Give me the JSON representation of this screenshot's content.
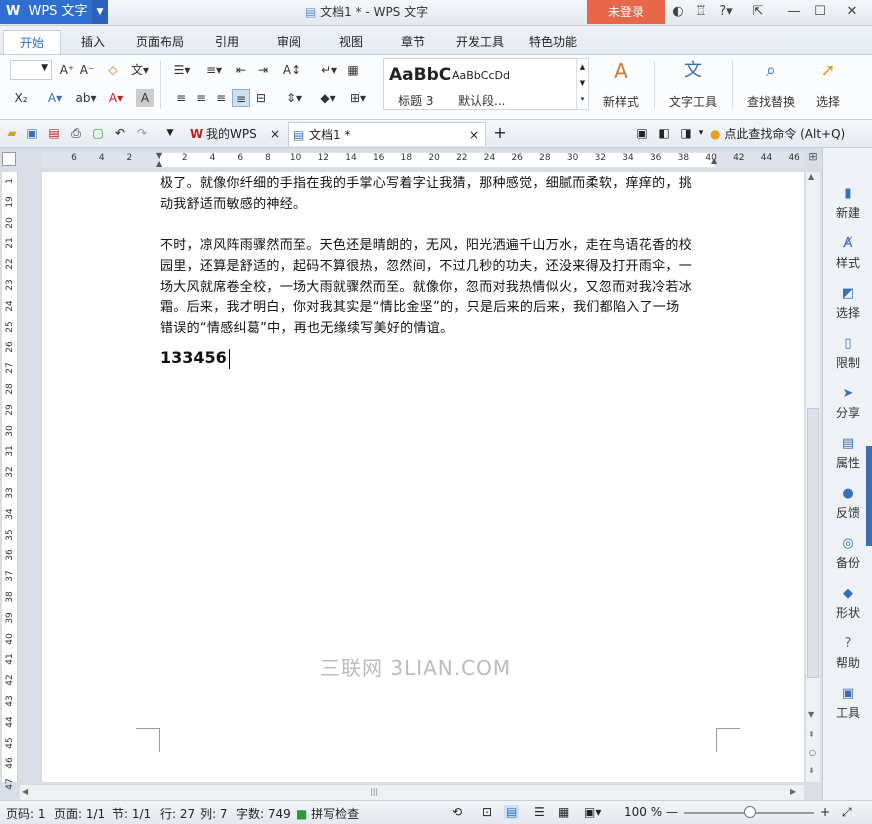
{
  "app": {
    "name": "WPS 文字",
    "window_title": "文档1 * - WPS 文字",
    "login_label": "未登录"
  },
  "menu": {
    "tabs": [
      "开始",
      "插入",
      "页面布局",
      "引用",
      "审阅",
      "视图",
      "章节",
      "开发工具",
      "特色功能"
    ]
  },
  "ribbon": {
    "style_preview_big": "AaBbC",
    "style_preview_small": "AaBbCcDd",
    "style_heading_label": "标题 3",
    "style_default_label": "默认段...",
    "new_style_label": "新样式",
    "text_tools_label": "文字工具",
    "find_replace_label": "查找替换",
    "select_label": "选择"
  },
  "doc_tabs": {
    "home": "我的WPS",
    "doc": "文档1 *"
  },
  "search_hint": "点此查找命令 (Alt+Q)",
  "ruler": {
    "h_numbers": [
      "6",
      "4",
      "2",
      "",
      "2",
      "4",
      "6",
      "8",
      "10",
      "12",
      "14",
      "16",
      "18",
      "20",
      "22",
      "24",
      "26",
      "28",
      "30",
      "32",
      "34",
      "36",
      "38",
      "40",
      "42",
      "44",
      "46"
    ],
    "v_numbers": [
      "1",
      "19",
      "20",
      "21",
      "22",
      "23",
      "24",
      "25",
      "26",
      "27",
      "28",
      "29",
      "30",
      "31",
      "32",
      "33",
      "34",
      "35",
      "36",
      "37",
      "38",
      "39",
      "40",
      "41",
      "42",
      "43",
      "44",
      "45",
      "46",
      "47"
    ]
  },
  "document": {
    "para1_line1": "极了。就像你纤细的手指在我的手掌心写着字让我猜，那种感觉，细腻而柔软，痒痒的，挑",
    "para1_line2": "动我舒适而敏感的神经。",
    "para2_line1": "不时，凉风阵雨骤然而至。天色还是晴朗的，无风，阳光洒遍千山万水，走在鸟语花香的校",
    "para2_line2": "园里，还算是舒适的，起码不算很热，忽然间，不过几秒的功夫，还没来得及打开雨伞，一",
    "para2_line3": "场大风就席卷全校，一场大雨就骤然而至。就像你，忽而对我热情似火，又忽而对我冷若冰",
    "para2_line4": "霜。后来，我才明白，你对我其实是“情比金坚”的，只是后来的后来，我们都陷入了一场",
    "para2_line5": "错误的“情感纠葛”中，再也无缘续写美好的情谊。",
    "typed_text": "133456",
    "watermark": "三联网 3LIAN.COM"
  },
  "sidebar": {
    "items": [
      "新建",
      "样式",
      "选择",
      "限制",
      "分享",
      "属性",
      "反馈",
      "备份",
      "形状",
      "帮助",
      "工具"
    ]
  },
  "status": {
    "page_code": "页码: 1",
    "page": "页面: 1/1",
    "section": "节: 1/1",
    "row": "行: 27",
    "col": "列: 7",
    "word_count": "字数: 749",
    "spell_check": "拼写检查",
    "zoom": "100 %"
  },
  "colors": {
    "accent": "#2f6fd1",
    "login_bg": "#e8664a"
  }
}
